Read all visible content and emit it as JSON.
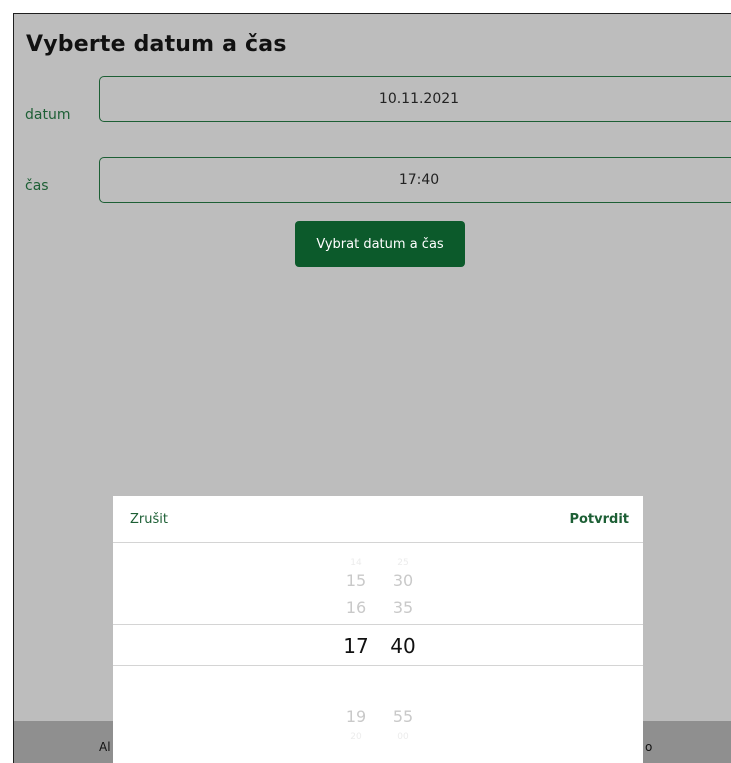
{
  "page": {
    "title": "Vyberte datum a čas"
  },
  "form": {
    "date_label": "datum",
    "date_value": "10.11.2021",
    "time_label": "čas",
    "time_value": "17:40",
    "submit_label": "Vybrat datum a čas"
  },
  "picker": {
    "cancel_label": "Zrušit",
    "confirm_label": "Potvrdit",
    "hours": {
      "far_above": "14",
      "above_2": "15",
      "above_1": "16",
      "selected": "17",
      "below_2": "19",
      "far_below": "20"
    },
    "minutes": {
      "far_above": "25",
      "above_2": "30",
      "above_1": "35",
      "selected": "40",
      "below_2": "55",
      "far_below": "00"
    }
  },
  "footer": {
    "left_text": "Al",
    "right_text": "o"
  }
}
